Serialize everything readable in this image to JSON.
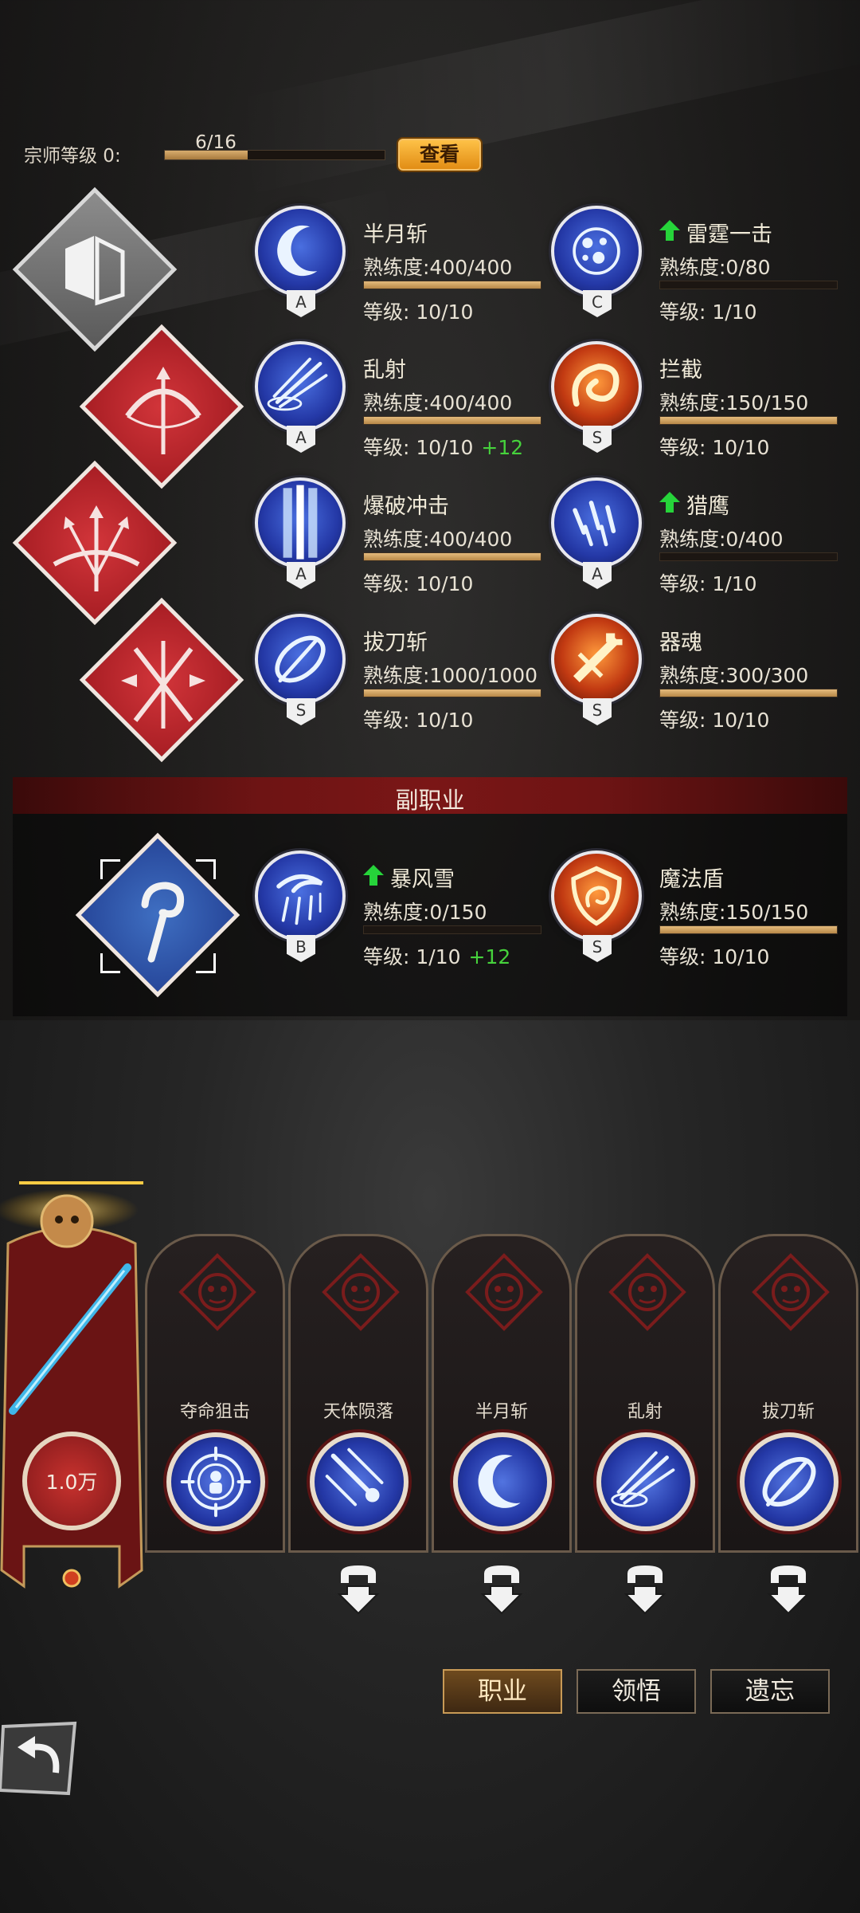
{
  "master": {
    "label": "宗师等级 0:",
    "progress_text": "6/16",
    "progress": 0.375,
    "view_button": "查看"
  },
  "skills": [
    {
      "name": "半月斩",
      "prof": "熟练度:400/400",
      "fill": 1.0,
      "level": "等级: 10/10",
      "bonus": "",
      "grade": "A",
      "arrow": false,
      "style": "blue",
      "icon": "crescent-moon-icon"
    },
    {
      "name": "雷霆一击",
      "prof": "熟练度:0/80",
      "fill": 0.0,
      "level": "等级: 1/10",
      "bonus": "",
      "grade": "C",
      "arrow": true,
      "style": "blue",
      "icon": "thunder-orb-icon"
    },
    {
      "name": "乱射",
      "prof": "熟练度:400/400",
      "fill": 1.0,
      "level": "等级: 10/10",
      "bonus": "+12",
      "grade": "A",
      "arrow": false,
      "style": "blue",
      "icon": "arrow-burst-icon"
    },
    {
      "name": "拦截",
      "prof": "熟练度:150/150",
      "fill": 1.0,
      "level": "等级: 10/10",
      "bonus": "",
      "grade": "S",
      "arrow": false,
      "style": "fire",
      "icon": "fire-swirl-icon"
    },
    {
      "name": "爆破冲击",
      "prof": "熟练度:400/400",
      "fill": 1.0,
      "level": "等级: 10/10",
      "bonus": "",
      "grade": "A",
      "arrow": false,
      "style": "blue",
      "icon": "light-pillar-icon"
    },
    {
      "name": "猎鹰",
      "prof": "熟练度:0/400",
      "fill": 0.0,
      "level": "等级: 1/10",
      "bonus": "",
      "grade": "A",
      "arrow": true,
      "style": "blue",
      "icon": "falcon-feathers-icon"
    },
    {
      "name": "拔刀斩",
      "prof": "熟练度:1000/1000",
      "fill": 1.0,
      "level": "等级: 10/10",
      "bonus": "",
      "grade": "S",
      "arrow": false,
      "style": "blue",
      "icon": "blade-ring-icon"
    },
    {
      "name": "器魂",
      "prof": "熟练度:300/300",
      "fill": 1.0,
      "level": "等级: 10/10",
      "bonus": "",
      "grade": "S",
      "arrow": false,
      "style": "fire",
      "icon": "sword-soul-icon"
    }
  ],
  "sub_class": {
    "title": "副职业",
    "skills": [
      {
        "name": "暴风雪",
        "prof": "熟练度:0/150",
        "fill": 0.0,
        "level": "等级: 1/10",
        "bonus": "+12",
        "grade": "B",
        "arrow": true,
        "style": "blue",
        "icon": "blizzard-icon"
      },
      {
        "name": "魔法盾",
        "prof": "熟练度:150/150",
        "fill": 1.0,
        "level": "等级: 10/10",
        "bonus": "",
        "grade": "S",
        "arrow": false,
        "style": "fire",
        "icon": "magic-shield-icon"
      }
    ]
  },
  "hero": {
    "value": "1.0万"
  },
  "cards": [
    {
      "name": "夺命狙击",
      "icon": "sniper-target-icon"
    },
    {
      "name": "天体陨落",
      "icon": "meteor-fall-icon"
    },
    {
      "name": "半月斩",
      "icon": "crescent-moon-icon"
    },
    {
      "name": "乱射",
      "icon": "arrow-burst-icon"
    },
    {
      "name": "拔刀斩",
      "icon": "blade-ring-icon"
    }
  ],
  "tabs": [
    "职业",
    "领悟",
    "遗忘"
  ],
  "colors": {
    "accent_gold": "#e8b564",
    "bonus_green": "#46d23c",
    "banner_red": "#7a1616",
    "orb_blue": "#2438a6"
  }
}
